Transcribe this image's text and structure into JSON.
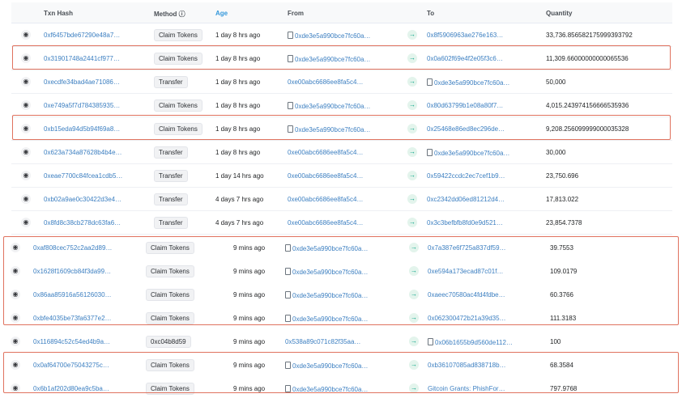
{
  "header": {
    "txn_hash": "Txn Hash",
    "method": "Method ⓘ",
    "age": "Age",
    "from": "From",
    "to": "To",
    "quantity": "Quantity"
  },
  "top_rows": [
    {
      "hash": "0xf6457bde67290e48a7…",
      "method": "Claim Tokens",
      "age": "1 day 8 hrs ago",
      "from": "0xde3e5a990bce7fc60a…",
      "from_contract": true,
      "to": "0x8f5906963ae276e163…",
      "to_contract": false,
      "qty": "33,736.856582175999393792"
    },
    {
      "hash": "0x31901748a2441cf977…",
      "method": "Claim Tokens",
      "age": "1 day 8 hrs ago",
      "from": "0xde3e5a990bce7fc60a…",
      "from_contract": true,
      "to": "0x0a602f69e4f2e05f3c6…",
      "to_contract": false,
      "qty": "11,309.66000000000065536"
    },
    {
      "hash": "0xecdfe34bad4ae71086…",
      "method": "Transfer",
      "age": "1 day 8 hrs ago",
      "from": "0xe00abc6686ee8fa5c4…",
      "from_contract": false,
      "to": "0xde3e5a990bce7fc60a…",
      "to_contract": true,
      "qty": "50,000"
    },
    {
      "hash": "0xe749a5f7d784385935…",
      "method": "Claim Tokens",
      "age": "1 day 8 hrs ago",
      "from": "0xde3e5a990bce7fc60a…",
      "from_contract": true,
      "to": "0x80d63799b1e08a80f7…",
      "to_contract": false,
      "qty": "4,015.243974156666535936"
    },
    {
      "hash": "0xb15eda94d5b94f69a8…",
      "method": "Claim Tokens",
      "age": "1 day 8 hrs ago",
      "from": "0xde3e5a990bce7fc60a…",
      "from_contract": true,
      "to": "0x25468e86ed8ec296de…",
      "to_contract": false,
      "qty": "9,208.256099999000035328"
    },
    {
      "hash": "0x623a734a87628b4b4e…",
      "method": "Transfer",
      "age": "1 day 8 hrs ago",
      "from": "0xe00abc6686ee8fa5c4…",
      "from_contract": false,
      "to": "0xde3e5a990bce7fc60a…",
      "to_contract": true,
      "qty": "30,000"
    },
    {
      "hash": "0xeae7700c84fcea1cdb5…",
      "method": "Transfer",
      "age": "1 day 14 hrs ago",
      "from": "0xe00abc6686ee8fa5c4…",
      "from_contract": false,
      "to": "0x59422ccdc2ec7cef1b9…",
      "to_contract": false,
      "qty": "23,750.696"
    },
    {
      "hash": "0xb02a9ae0c30422d3e4…",
      "method": "Transfer",
      "age": "4 days 7 hrs ago",
      "from": "0xe00abc6686ee8fa5c4…",
      "from_contract": false,
      "to": "0xc2342dd06ed81212d4…",
      "to_contract": false,
      "qty": "17,813.022"
    },
    {
      "hash": "0x8fd8c38cb278dc63fa6…",
      "method": "Transfer",
      "age": "4 days 7 hrs ago",
      "from": "0xe00abc6686ee8fa5c4…",
      "from_contract": false,
      "to": "0x3c3befbfb8fd0e9d521…",
      "to_contract": false,
      "qty": "23,854.7378"
    }
  ],
  "bottom_rows": [
    {
      "hash": "0xaf808cec752c2aa2d89…",
      "method": "Claim Tokens",
      "age": "9 mins ago",
      "from": "0xde3e5a990bce7fc60a…",
      "from_contract": true,
      "to": "0x7a387e6f725a837df59…",
      "to_contract": false,
      "qty": "39.7553"
    },
    {
      "hash": "0x1628f1609cb84f3da99…",
      "method": "Claim Tokens",
      "age": "9 mins ago",
      "from": "0xde3e5a990bce7fc60a…",
      "from_contract": true,
      "to": "0xe594a173ecad87c01f…",
      "to_contract": false,
      "qty": "109.0179"
    },
    {
      "hash": "0x86aa85916a56126030…",
      "method": "Claim Tokens",
      "age": "9 mins ago",
      "from": "0xde3e5a990bce7fc60a…",
      "from_contract": true,
      "to": "0xaeec70580ac4fd4fdbe…",
      "to_contract": false,
      "qty": "60.3766"
    },
    {
      "hash": "0xbfe4035be73fa6377e2…",
      "method": "Claim Tokens",
      "age": "9 mins ago",
      "from": "0xde3e5a990bce7fc60a…",
      "from_contract": true,
      "to": "0x062300472b21a39d35…",
      "to_contract": false,
      "qty": "111.3183"
    },
    {
      "hash": "0x116894c52c54ed4b9a…",
      "method": "0xc04b8d59",
      "age": "9 mins ago",
      "from": "0x538a89c071c82f35aa…",
      "from_contract": false,
      "to": "0x06b1655b9d560de112…",
      "to_contract": true,
      "qty": "100"
    },
    {
      "hash": "0x0af64700e75043275c…",
      "method": "Claim Tokens",
      "age": "9 mins ago",
      "from": "0xde3e5a990bce7fc60a…",
      "from_contract": true,
      "to": "0xb36107085ad838718b…",
      "to_contract": false,
      "qty": "68.3584"
    },
    {
      "hash": "0x6b1af202d80ea9c5ba…",
      "method": "Claim Tokens",
      "age": "9 mins ago",
      "from": "0xde3e5a990bce7fc60a…",
      "from_contract": true,
      "to": "Gitcoin Grants: PhishFor…",
      "to_contract": false,
      "qty": "797.9768"
    }
  ],
  "icons": {
    "eye": "eye-icon",
    "arrow": "arrow-right-icon",
    "contract": "contract-document-icon"
  },
  "colors": {
    "link": "#3c7fc1",
    "highlight": "#e0735f",
    "arrow_bg": "#e3f4ec",
    "arrow_fg": "#00a186"
  }
}
